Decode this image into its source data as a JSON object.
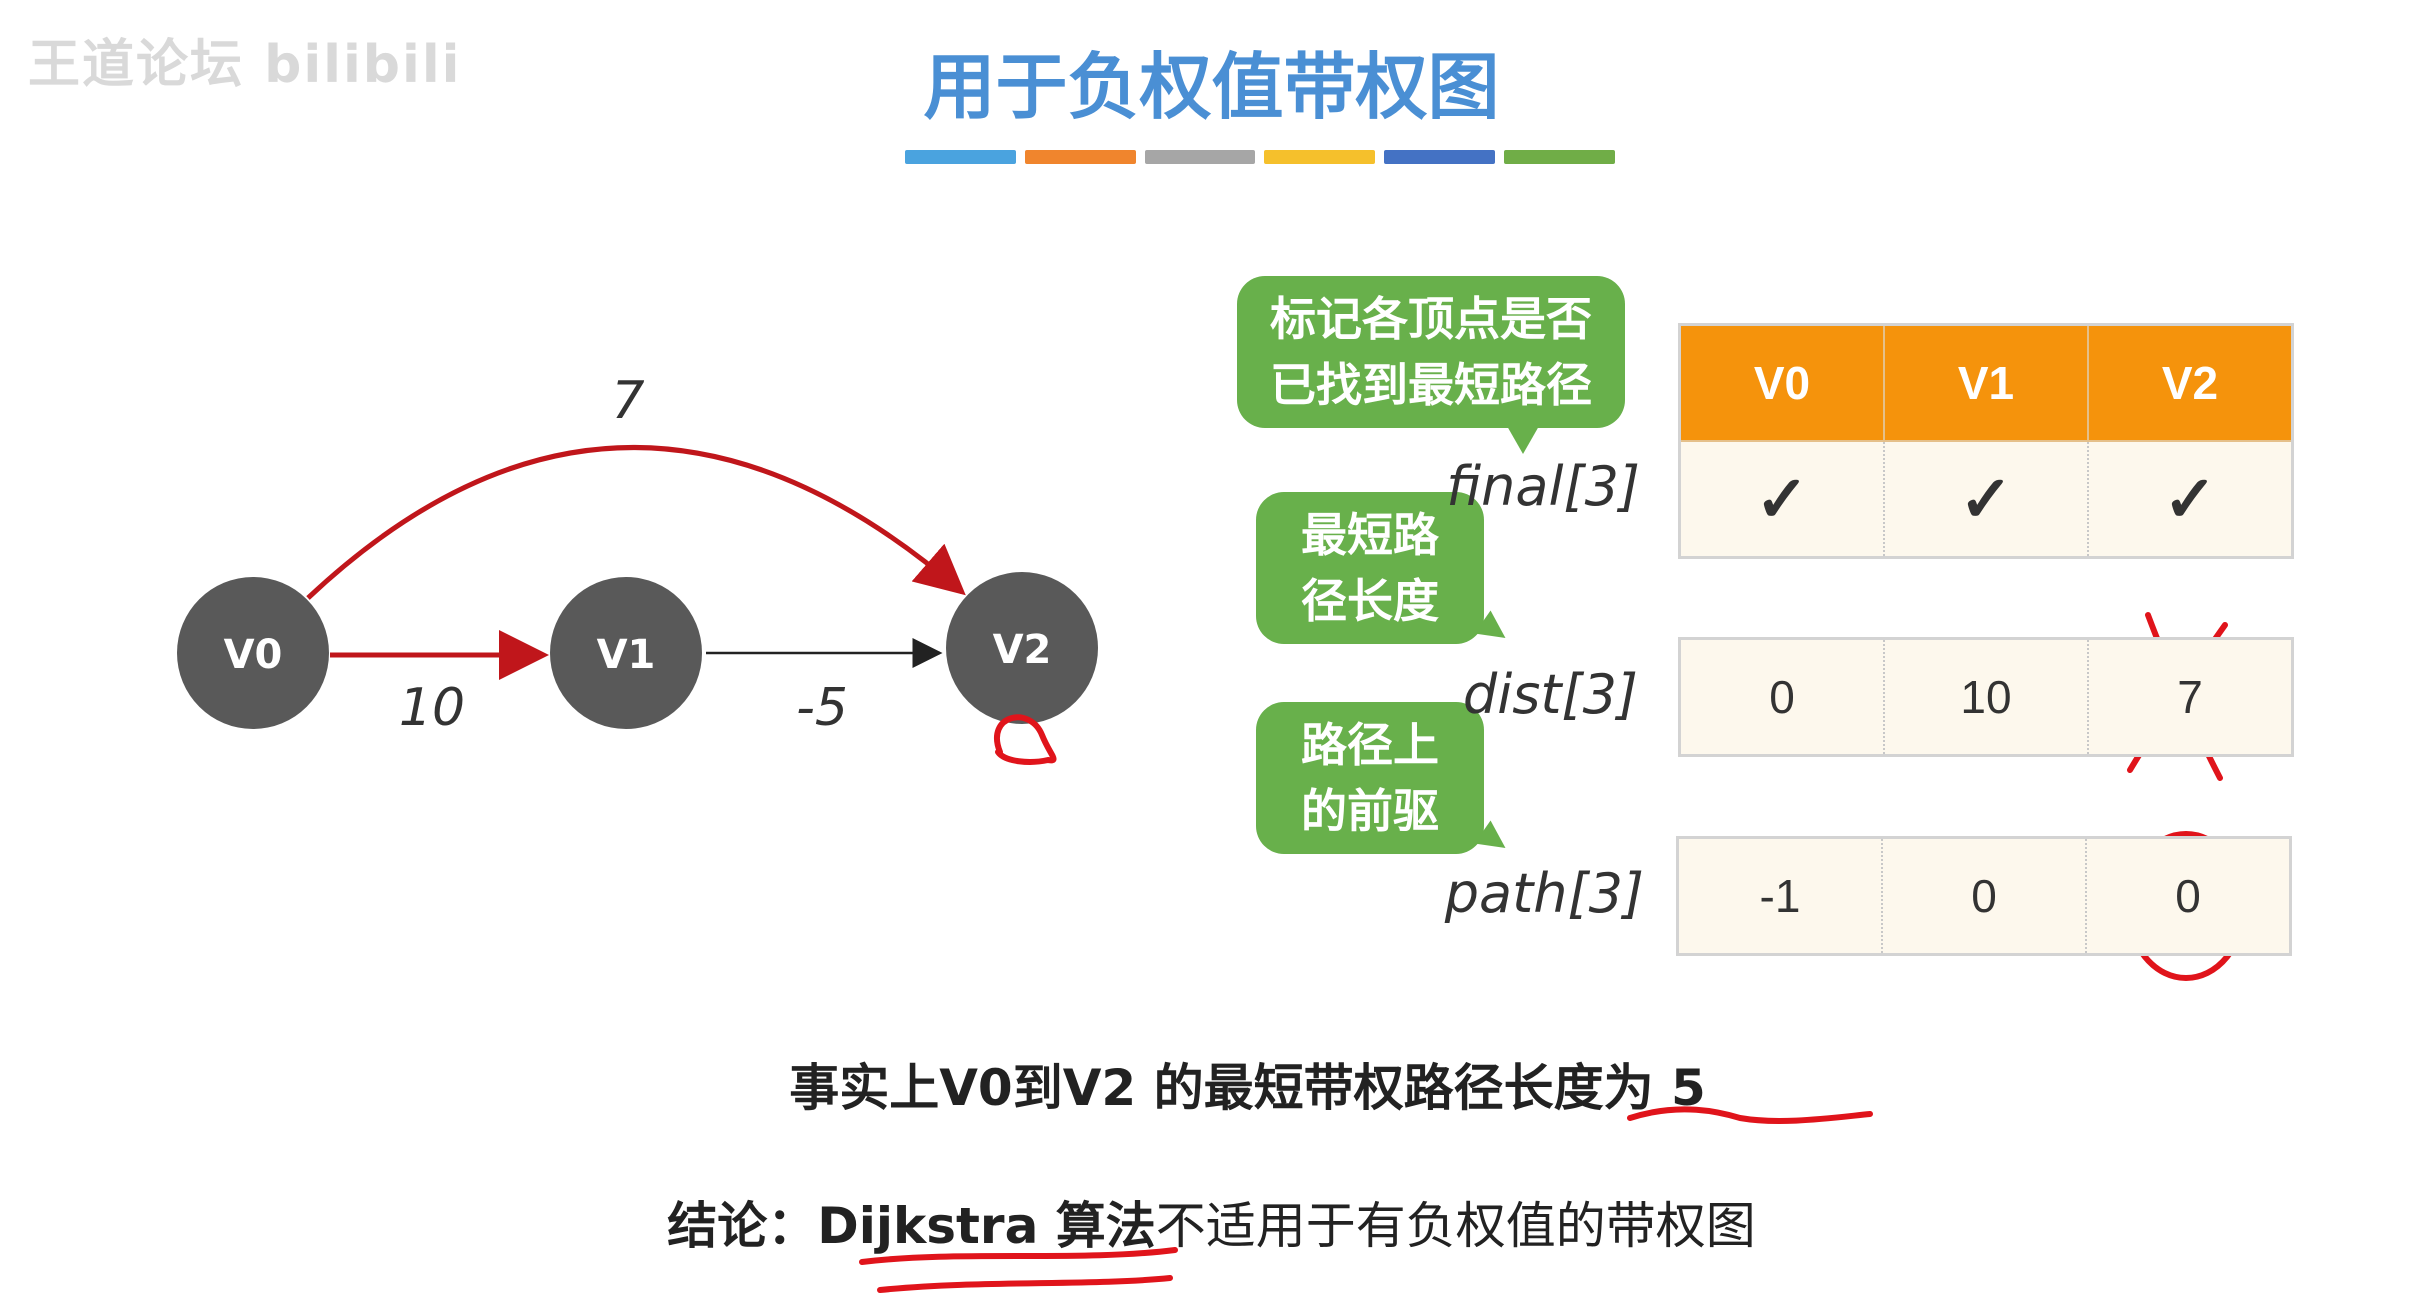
{
  "watermark": "王道论坛 bilibili",
  "title": "用于负权值带权图",
  "title_bar_colors": [
    "#4aa3df",
    "#f0852d",
    "#a6a6a6",
    "#f5c02c",
    "#4472c4",
    "#70ad47"
  ],
  "graph": {
    "nodes": [
      "V0",
      "V1",
      "V2"
    ],
    "edges": [
      {
        "from": "V0",
        "to": "V2",
        "weight": "7"
      },
      {
        "from": "V0",
        "to": "V1",
        "weight": "10"
      },
      {
        "from": "V1",
        "to": "V2",
        "weight": "-5"
      }
    ]
  },
  "bubbles": {
    "final": [
      "标记各顶点是否",
      "已找到最短路径"
    ],
    "dist": [
      "最短路",
      "径长度"
    ],
    "path": [
      "路径上",
      "的前驱"
    ]
  },
  "table": {
    "headers": [
      "V0",
      "V1",
      "V2"
    ],
    "rows": [
      {
        "label": "final[3]",
        "cells": [
          "✓",
          "✓",
          "✓"
        ]
      },
      {
        "label": "dist[3]",
        "cells": [
          "0",
          "10",
          "7"
        ]
      },
      {
        "label": "path[3]",
        "cells": [
          "-1",
          "0",
          "0"
        ]
      }
    ]
  },
  "caption1": {
    "prefix": "事实上V0到V2 的最短带权路径长度",
    "word": "为",
    "value": " 5"
  },
  "caption2": {
    "prefix": "结论：",
    "emph": "Dijkstra 算法",
    "rest": "不适用于有负权值的带权图"
  },
  "colors": {
    "node": "#595959",
    "red_edge": "#c0161b",
    "header": "#f5930c",
    "bubble": "#68b04b",
    "annotation": "#e0141b",
    "title": "#4a8fd4"
  }
}
